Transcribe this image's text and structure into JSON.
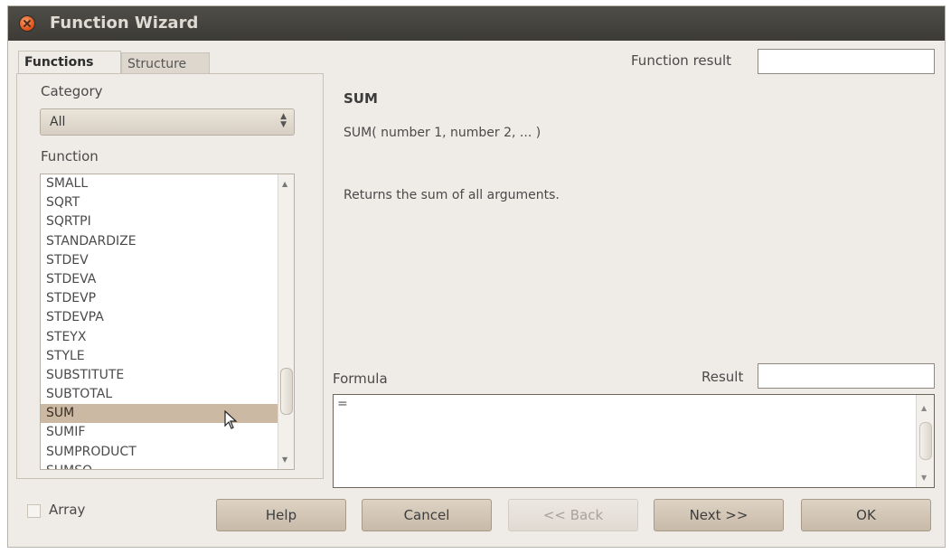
{
  "window": {
    "title": "Function Wizard"
  },
  "tabs": {
    "functions": "Functions",
    "structure": "Structure"
  },
  "category": {
    "label": "Category",
    "value": "All"
  },
  "function": {
    "label": "Function",
    "items": [
      "SMALL",
      "SQRT",
      "SQRTPI",
      "STANDARDIZE",
      "STDEV",
      "STDEVA",
      "STDEVP",
      "STDEVPA",
      "STEYX",
      "STYLE",
      "SUBSTITUTE",
      "SUBTOTAL",
      "SUM",
      "SUMIF",
      "SUMPRODUCT",
      "SUMSQ"
    ],
    "selected": "SUM"
  },
  "function_result": {
    "label": "Function result",
    "value": ""
  },
  "details": {
    "name": "SUM",
    "syntax": "SUM( number 1, number 2, ... )",
    "description": "Returns the sum of all arguments."
  },
  "formula": {
    "label": "Formula",
    "value": "="
  },
  "result": {
    "label": "Result",
    "value": ""
  },
  "array_label": "Array",
  "buttons": {
    "help": "Help",
    "cancel": "Cancel",
    "back": "<< Back",
    "next": "Next >>",
    "ok": "OK"
  }
}
